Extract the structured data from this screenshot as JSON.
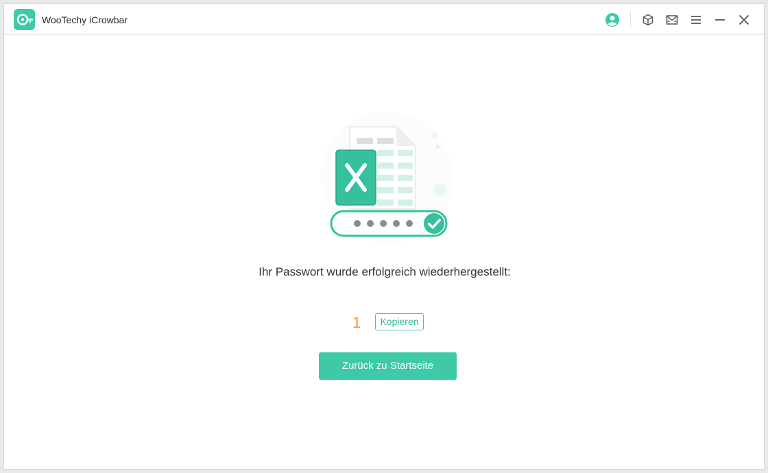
{
  "window": {
    "title": "WooTechy iCrowbar",
    "icons": [
      "logo-icon",
      "user-icon",
      "box-icon",
      "mail-icon",
      "menu-icon",
      "minimize-icon",
      "close-icon"
    ]
  },
  "main": {
    "message": "Ihr Passwort wurde erfolgreich wiederhergestellt:",
    "password_value": "1",
    "copy_label": "Kopieren",
    "home_button_label": "Zurück zu Startseite",
    "illustration_icon": "excel-password-icon"
  },
  "colors": {
    "accent": "#3ec9a7",
    "password": "#f5922b",
    "text": "#333333"
  }
}
